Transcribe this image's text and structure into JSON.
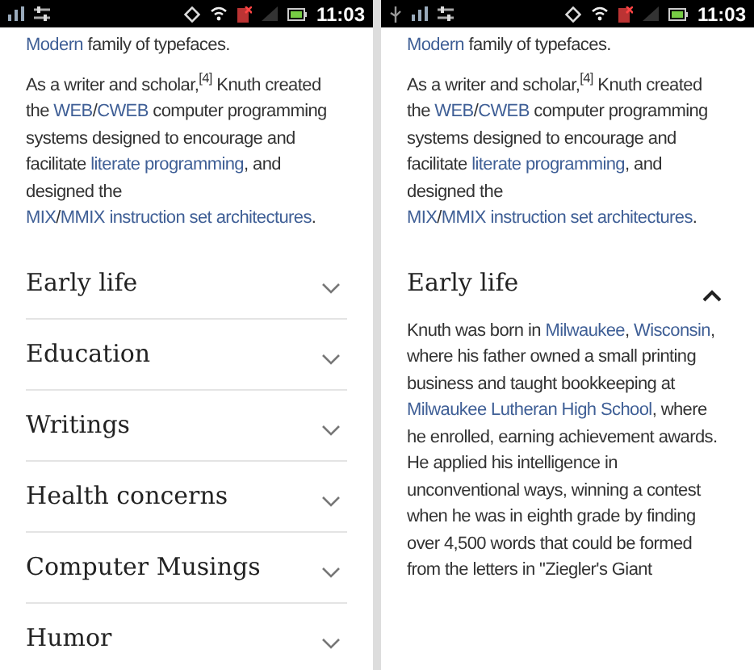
{
  "screens": [
    {
      "status_bar": {
        "time": "11:03"
      },
      "paragraphs": [
        [
          {
            "text": "Modern",
            "link": true
          },
          {
            "text": " family of typefaces.",
            "link": false
          }
        ],
        [
          {
            "text": "As a writer and scholar,$^{[4]}$ Knuth created the ",
            "link": false
          },
          {
            "text": "WEB",
            "link": true
          },
          {
            "text": "/",
            "link": false
          },
          {
            "text": "CWEB",
            "link": true
          },
          {
            "text": " computer programming systems designed to encourage and facilitate ",
            "link": false
          },
          {
            "text": "literate programming",
            "link": true
          },
          {
            "text": ", and designed the ",
            "link": false
          },
          {
            "text": "MIX",
            "link": true
          },
          {
            "text": "/",
            "link": false
          },
          {
            "text": "MMIX ",
            "link": true
          },
          {
            "text": "instruction set architectures",
            "link": true
          },
          {
            "text": ".",
            "link": false
          }
        ]
      ],
      "sections": [
        {
          "title": "Early life",
          "expanded": false
        },
        {
          "title": "Education",
          "expanded": false
        },
        {
          "title": "Writings",
          "expanded": false
        },
        {
          "title": "Health concerns",
          "expanded": false
        },
        {
          "title": "Computer Musings",
          "expanded": false
        },
        {
          "title": "Humor",
          "expanded": false
        }
      ]
    },
    {
      "status_bar": {
        "time": "11:03"
      },
      "paragraphs": [
        [
          {
            "text": "Modern",
            "link": true
          },
          {
            "text": " family of typefaces.",
            "link": false
          }
        ],
        [
          {
            "text": "As a writer and scholar,$^{[4]}$ Knuth created the ",
            "link": false
          },
          {
            "text": "WEB",
            "link": true
          },
          {
            "text": "/",
            "link": false
          },
          {
            "text": "CWEB",
            "link": true
          },
          {
            "text": " computer programming systems designed to encourage and facilitate ",
            "link": false
          },
          {
            "text": "literate programming",
            "link": true
          },
          {
            "text": ", and designed the ",
            "link": false
          },
          {
            "text": "MIX",
            "link": true
          },
          {
            "text": "/",
            "link": false
          },
          {
            "text": "MMIX ",
            "link": true
          },
          {
            "text": "instruction set architectures",
            "link": true
          },
          {
            "text": ".",
            "link": false
          }
        ]
      ],
      "sections": [
        {
          "title": "Early life",
          "expanded": true,
          "paragraphs": [
            [
              {
                "text": "Knuth was born in ",
                "link": false
              },
              {
                "text": "Milwaukee",
                "link": true
              },
              {
                "text": ", ",
                "link": false
              },
              {
                "text": "Wisconsin",
                "link": true
              },
              {
                "text": ", where his father owned a small printing business and taught bookkeeping at ",
                "link": false
              },
              {
                "text": "Milwaukee Lutheran High School",
                "link": true
              },
              {
                "text": ", where he enrolled, earning achievement awards. He applied his intelligence in unconventional ways, winning a contest when he was in eighth grade by finding over 4,500 words that could be formed from the letters in \"Ziegler's Giant",
                "link": false
              }
            ]
          ]
        }
      ]
    }
  ]
}
